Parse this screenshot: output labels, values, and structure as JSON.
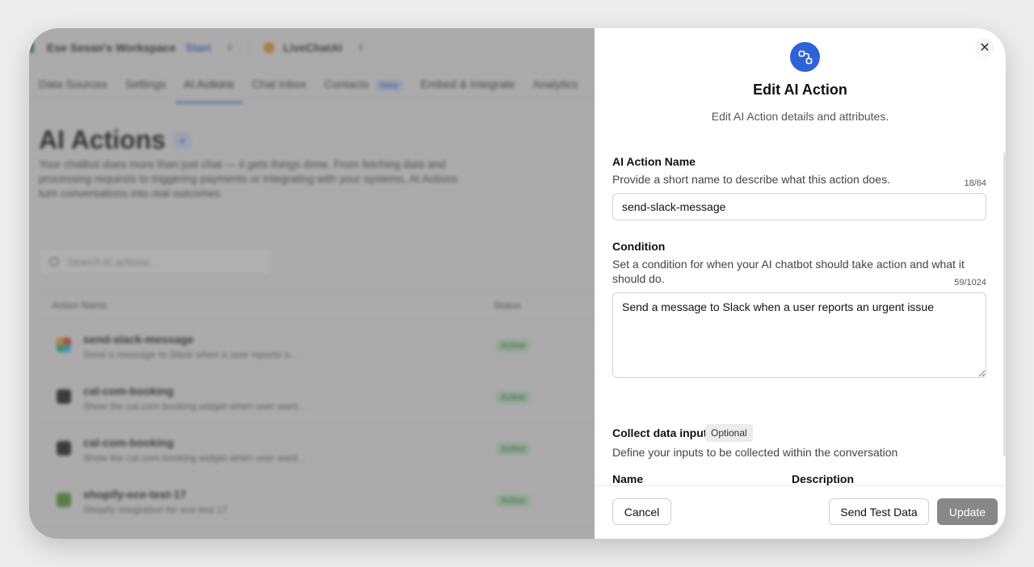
{
  "background": {
    "workspace_name": "Ese Sesan's Workspace",
    "workspace_plan": "Start",
    "bot_name": "LiveChatAI",
    "tabs": [
      {
        "label": "Data Sources"
      },
      {
        "label": "Settings"
      },
      {
        "label": "AI Actions"
      },
      {
        "label": "Chat Inbox"
      },
      {
        "label": "Contacts",
        "badge": "New"
      },
      {
        "label": "Embed & Integrate"
      },
      {
        "label": "Analytics"
      }
    ],
    "page_title": "AI Actions",
    "page_description": "Your chatbot does more than just chat — it gets things done. From fetching data and processing requests to triggering payments or integrating with your systems, AI Actions turn conversations into real outcomes.",
    "search_placeholder": "Search AI actions...",
    "table_headers": {
      "name": "Action Name",
      "status": "Status"
    },
    "rows": [
      {
        "name": "send-slack-message",
        "desc": "Send a message to Slack when a user reports a...",
        "status": "Active",
        "icon_color": "#e0463d"
      },
      {
        "name": "cal-com-booking",
        "desc": "Show the cal.com booking widget when user want...",
        "status": "Active",
        "icon_color": "#222222"
      },
      {
        "name": "cal-com-booking",
        "desc": "Show the cal.com booking widget when user want...",
        "status": "Active",
        "icon_color": "#222222"
      },
      {
        "name": "shopify-ece-test-17",
        "desc": "Shopify integration for ece test 17",
        "status": "Active",
        "icon_color": "#5e9e3a"
      }
    ]
  },
  "modal": {
    "title": "Edit AI Action",
    "subtitle": "Edit AI Action details and attributes.",
    "name_field": {
      "label": "AI Action Name",
      "help": "Provide a short name to describe what this action does.",
      "count": "18/64",
      "value": "send-slack-message"
    },
    "condition_field": {
      "label": "Condition",
      "help": "Set a condition for when your AI chatbot should take action and what it should do.",
      "count": "59/1024",
      "value": "Send a message to Slack when a user reports an urgent issue"
    },
    "collect": {
      "label": "Collect data input",
      "badge": "Optional",
      "help": "Define your inputs to be collected within the conversation",
      "col_name": "Name",
      "col_description": "Description"
    },
    "buttons": {
      "cancel": "Cancel",
      "send_test": "Send Test Data",
      "update": "Update"
    },
    "colors": {
      "accent": "#2f62d8",
      "update_disabled": "#888888"
    }
  }
}
